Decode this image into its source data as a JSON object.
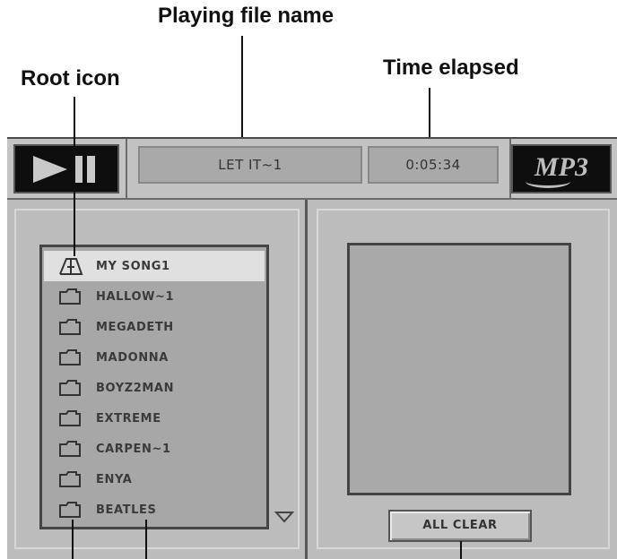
{
  "callouts": {
    "playing_file_name": "Playing file name",
    "root_icon": "Root icon",
    "time_elapsed": "Time elapsed"
  },
  "player": {
    "status_icon": "play-pause-icon",
    "current_file": "LET IT~1",
    "time_elapsed": "0:05:34",
    "logo_text": "MP3"
  },
  "folder_list": {
    "items": [
      {
        "label": "MY SONG1",
        "icon": "root-icon",
        "selected": true
      },
      {
        "label": "HALLOW~1",
        "icon": "folder-icon"
      },
      {
        "label": "MEGADETH",
        "icon": "folder-icon"
      },
      {
        "label": "MADONNA",
        "icon": "folder-icon"
      },
      {
        "label": "BOYZ2MAN",
        "icon": "folder-icon"
      },
      {
        "label": "EXTREME",
        "icon": "folder-icon"
      },
      {
        "label": "CARPEN~1",
        "icon": "folder-icon"
      },
      {
        "label": "ENYA",
        "icon": "folder-icon"
      },
      {
        "label": "BEATLES",
        "icon": "folder-icon"
      }
    ]
  },
  "buttons": {
    "all_clear": "ALL CLEAR"
  },
  "colors": {
    "panel": "#bcbcbc",
    "lcd": "#a9a9a9",
    "selected_row": "#e0e0e0",
    "black_box": "#0e0e0e"
  }
}
